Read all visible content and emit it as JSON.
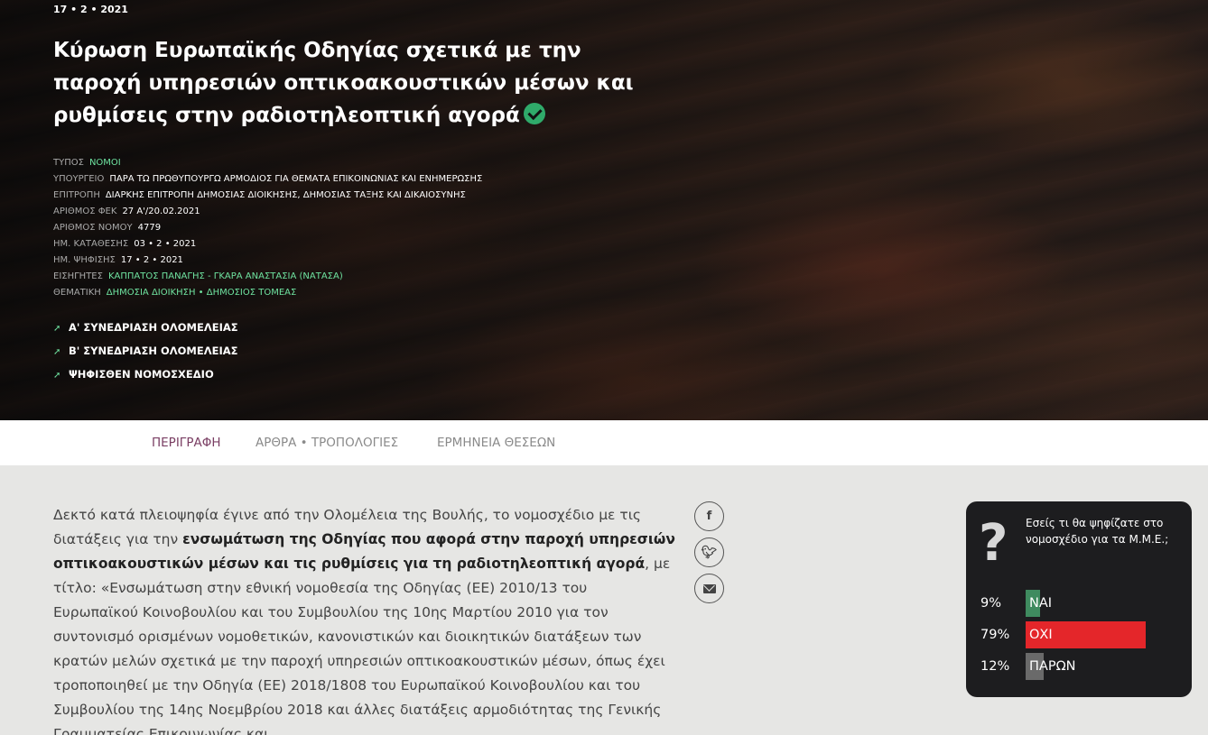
{
  "hero": {
    "date": "17 • 2 • 2021",
    "title": "Κύρωση Ευρωπαϊκής Οδηγίας σχετικά με την παροχή υπηρεσιών οπτικοακουστικών μέσων και ρυθμίσεις στην ραδιοτηλεοπτική αγορά",
    "meta": [
      {
        "key": "ΤΥΠΟΣ",
        "value": "ΝΟΜΟΙ",
        "highlight": true
      },
      {
        "key": "ΥΠΟΥΡΓΕΙΟ",
        "value": "ΠΑΡΑ ΤΩ ΠΡΩΘΥΠΟΥΡΓΩ ΑΡΜΟΔΙΟΣ ΓΙΑ ΘΕΜΑΤΑ ΕΠΙΚΟΙΝΩΝΙΑΣ ΚΑΙ ΕΝΗΜΕΡΩΣΗΣ",
        "highlight": false
      },
      {
        "key": "ΕΠΙΤΡΟΠΗ",
        "value": "ΔΙΑΡΚΗΣ ΕΠΙΤΡΟΠΗ ΔΗΜΟΣΙΑΣ ΔΙΟΙΚΗΣΗΣ, ΔΗΜΟΣΙΑΣ ΤΑΞΗΣ ΚΑΙ ΔΙΚΑΙΟΣΥΝΗΣ",
        "highlight": false
      },
      {
        "key": "ΑΡΙΘΜΟΣ ΦΕΚ",
        "value": "27 Α'/20.02.2021",
        "highlight": false
      },
      {
        "key": "ΑΡΙΘΜΟΣ ΝΟΜΟΥ",
        "value": "4779",
        "highlight": false
      },
      {
        "key": "ΗΜ. ΚΑΤΑΘΕΣΗΣ",
        "value": "03 • 2 • 2021",
        "highlight": false
      },
      {
        "key": "ΗΜ. ΨΗΦΙΣΗΣ",
        "value": "17 • 2 • 2021",
        "highlight": false
      },
      {
        "key": "ΕΙΣΗΓΗΤΕΣ",
        "value": "ΚΑΠΠΑΤΟΣ ΠΑΝΑΓΗΣ - ΓΚΑΡΑ ΑΝΑΣΤΑΣΙΑ (ΝΑΤΑΣΑ)",
        "highlight": true
      },
      {
        "key": "ΘΕΜΑΤΙΚΗ",
        "value": "ΔΗΜΟΣΙΑ ΔΙΟΙΚΗΣΗ • ΔΗΜΟΣΙΟΣ ΤΟΜΕΑΣ",
        "highlight": true
      }
    ],
    "links": [
      "Α' ΣΥΝΕΔΡΙΑΣΗ ΟΛΟΜΕΛΕΙΑΣ",
      "Β' ΣΥΝΕΔΡΙΑΣΗ ΟΛΟΜΕΛΕΙΑΣ",
      "ΨΗΦΙΣΘΕΝ ΝΟΜΟΣΧΕΔΙΟ"
    ]
  },
  "tabs": [
    {
      "label": "ΠΕΡΙΓΡΑΦΗ",
      "active": true
    },
    {
      "label": "ΑΡΘΡΑ • ΤΡΟΠΟΛΟΓΙΕΣ",
      "active": false
    },
    {
      "label": "ΕΡΜΗΝΕΙΑ ΘΕΣΕΩΝ",
      "active": false
    }
  ],
  "article": {
    "intro": "Δεκτό κατά πλειοψηφία έγινε από την Ολομέλεια της Βουλής, το νομοσχέδιο με τις διατάξεις για την ",
    "bold": "ενσωμάτωση της Οδηγίας που αφορά στην παροχή υπηρεσιών οπτικοακουστικών μέσων και τις ρυθμίσεις για τη ραδιοτηλεοπτική αγορά",
    "rest": ", με τίτλο: «Ενσωμάτωση στην εθνική νομοθεσία της Οδηγίας (ΕΕ) 2010/13 του Ευρωπαϊκού Κοινοβουλίου και του Συμβουλίου της 10ης Μαρτίου 2010 για τον συντονισμό ορισμένων νομοθετικών, κανονιστικών και διοικητικών διατάξεων των κρατών μελών σχετικά με την παροχή υπηρεσιών οπτικοακουστικών μέσων, όπως έχει τροποποιηθεί με την Οδηγία (ΕΕ) 2018/1808 του Ευρωπαϊκού Κοινοβουλίου και του Συμβουλίου της 14ης Νοεμβρίου 2018 και άλλες διατάξεις αρμοδιότητας της Γενικής Γραμματείας Επικοινωνίας και"
  },
  "share": {
    "facebook_glyph": "f",
    "icons": [
      "facebook-icon",
      "twitter-icon",
      "envelope-icon"
    ]
  },
  "poll": {
    "question": "Εσείς τι θα ψηφίζατε στο νομοσχέδιο για τα Μ.Μ.Ε.;",
    "icon": "question-icon",
    "options": [
      {
        "pct": "9%",
        "value": 9,
        "label": "ΝΑΙ",
        "color": "#3f8b5f"
      },
      {
        "pct": "79%",
        "value": 79,
        "label": "ΟΧΙ",
        "color": "#e4262a"
      },
      {
        "pct": "12%",
        "value": 12,
        "label": "ΠΑΡΩΝ",
        "color": "#6a6a6a"
      }
    ]
  }
}
